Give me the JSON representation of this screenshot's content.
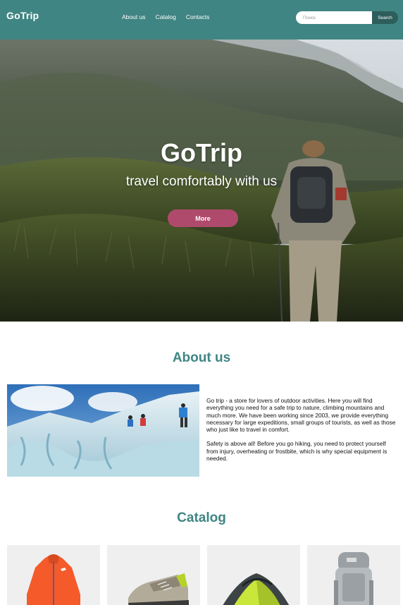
{
  "header": {
    "logo": "GoTrip",
    "nav": [
      "About us",
      "Catalog",
      "Contacts"
    ],
    "search": {
      "placeholder": "Поиск",
      "button": "Search"
    }
  },
  "hero": {
    "title": "GoTrip",
    "subtitle": "travel comfortably with us",
    "button": "More"
  },
  "about": {
    "title": "About us",
    "paragraphs": [
      "Go trip - a store for lovers of outdoor activities. Here you will find everything you need for a safe trip to nature, climbing mountains and much more. We have been working since 2003, we provide everything necessary for large expeditions, small groups of tourists, as well as those who just like to travel in comfort.",
      "Safety is above all! Before you go hiking, you need to protect yourself from injury, overheating or frostbite, which is why special equipment is needed."
    ]
  },
  "catalog": {
    "title": "Catalog",
    "items": [
      {
        "icon": "jacket-image"
      },
      {
        "icon": "hiking-shoe-image"
      },
      {
        "icon": "tent-image"
      },
      {
        "icon": "backpack-image"
      }
    ]
  },
  "colors": {
    "header_bg": "#3f8583",
    "accent": "#3f8583",
    "button_pink": "#b04a6c",
    "search_button": "#2d5e5c"
  }
}
